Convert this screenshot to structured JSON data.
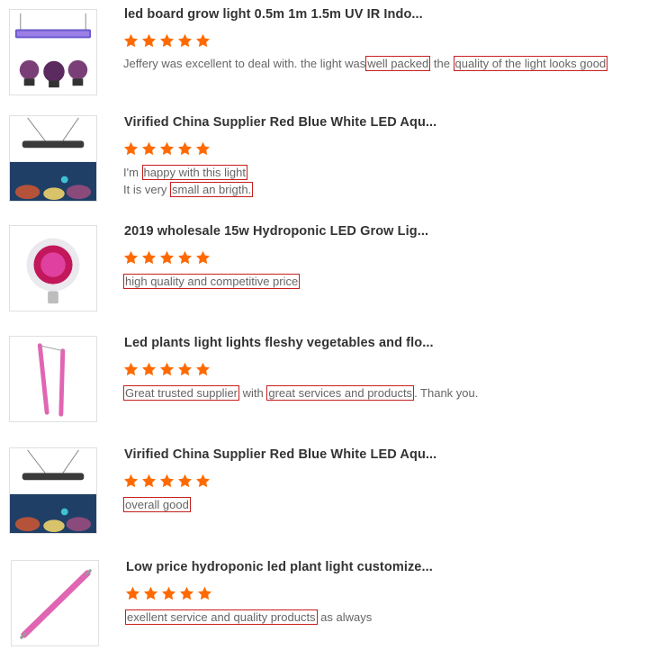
{
  "colors": {
    "star": "#ff6a00",
    "highlight_border": "#c81e1e",
    "title": "#333333",
    "text": "#666666"
  },
  "rating_icon": "star-icon",
  "reviews": [
    {
      "title": "led board grow light 0.5m 1m 1.5m UV IR Indo...",
      "rating": 5,
      "lines": [
        [
          {
            "text": "Jeffery was excellent to deal with. the light was",
            "hl": false
          },
          {
            "text": "well packed",
            "hl": true
          },
          {
            "text": " the ",
            "hl": false
          },
          {
            "text": "quality of the light looks good",
            "hl": true
          }
        ]
      ]
    },
    {
      "title": "Virified China Supplier Red Blue White LED Aqu...",
      "rating": 5,
      "lines": [
        [
          {
            "text": "I'm ",
            "hl": false
          },
          {
            "text": "happy with this light",
            "hl": true
          }
        ],
        [
          {
            "text": "It is very ",
            "hl": false
          },
          {
            "text": "small an brigth.",
            "hl": true
          }
        ]
      ]
    },
    {
      "title": "2019 wholesale 15w Hydroponic LED Grow Lig...",
      "rating": 5,
      "lines": [
        [
          {
            "text": "high quality and competitive price",
            "hl": true
          }
        ]
      ]
    },
    {
      "title": "Led plants light lights fleshy vegetables and flo...",
      "rating": 5,
      "lines": [
        [
          {
            "text": "Great trusted supplier",
            "hl": true
          },
          {
            "text": " with ",
            "hl": false
          },
          {
            "text": "great services and products",
            "hl": true
          },
          {
            "text": ". Thank you.",
            "hl": false
          }
        ]
      ]
    },
    {
      "title": "Virified China Supplier Red Blue White LED Aqu...",
      "rating": 5,
      "lines": [
        [
          {
            "text": "overall good  ",
            "hl": true
          }
        ]
      ]
    },
    {
      "title": "Low price hydroponic led plant light customize...",
      "rating": 5,
      "lines": [
        [
          {
            "text": "exellent service and quality products",
            "hl": true
          },
          {
            "text": " as always",
            "hl": false
          }
        ]
      ]
    }
  ]
}
